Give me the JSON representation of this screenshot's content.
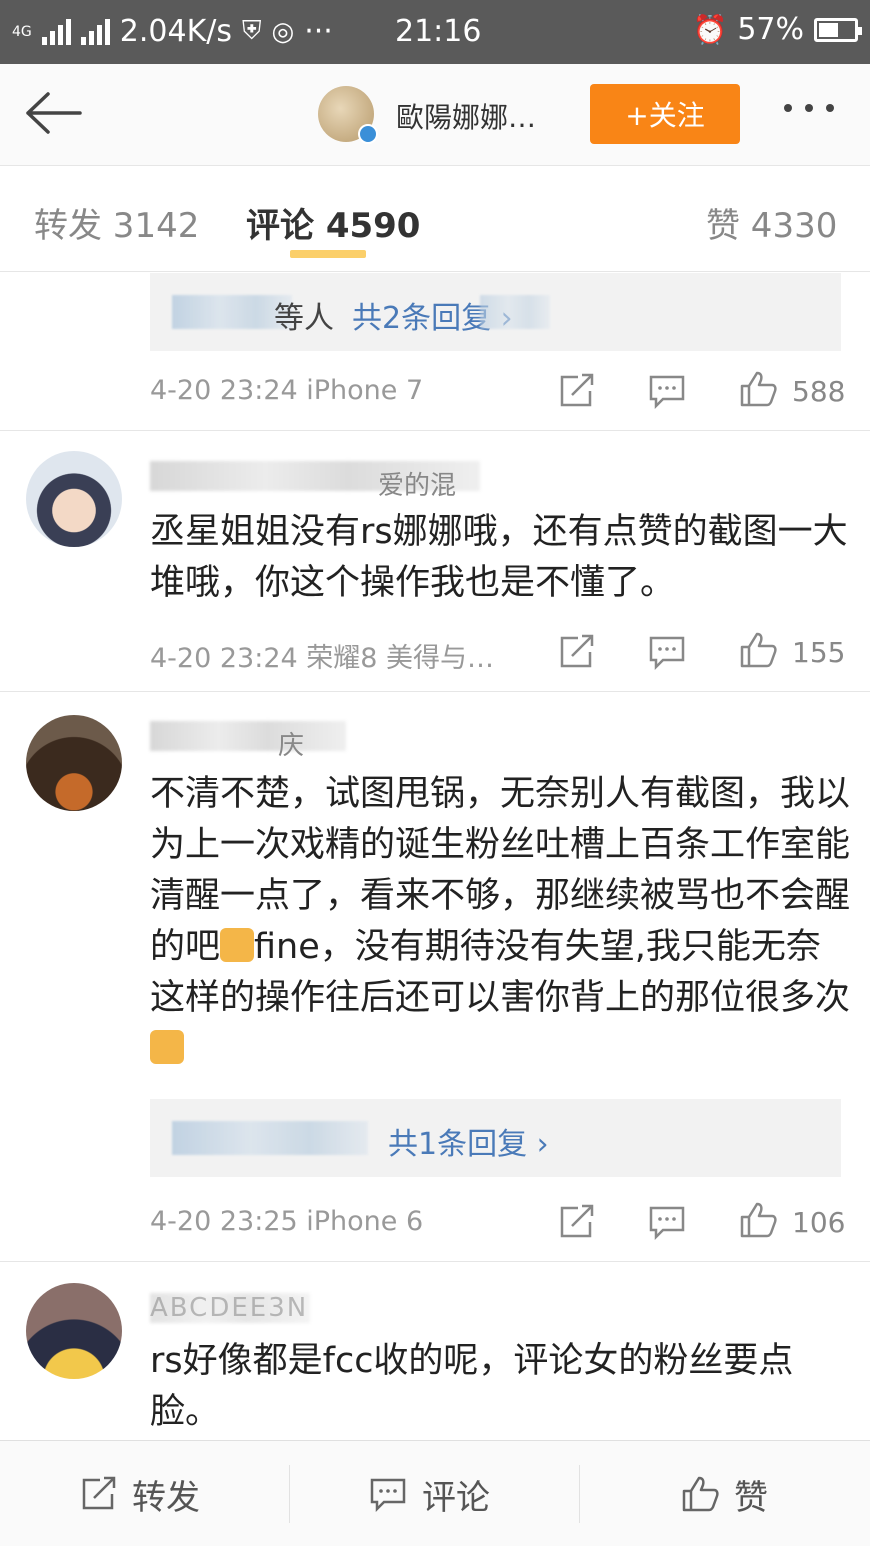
{
  "statusbar": {
    "network_1": "4G",
    "speed": "2.04K/s",
    "time": "21:16",
    "battery": "57%",
    "battery_level": 0.57
  },
  "header": {
    "username": "歐陽娜娜…",
    "follow_label": "+关注"
  },
  "tabs": {
    "repost": "转发 3142",
    "comment": "评论 4590",
    "like": "赞 4330"
  },
  "comments": [
    {
      "reply_box_name_visible": "等人",
      "reply_box_text": "共2条回复 ›",
      "meta": "4-20 23:24  iPhone 7",
      "likes": "588"
    },
    {
      "username_visible": "爱的混",
      "text": "丞星姐姐没有rs娜娜哦，还有点赞的截图一大堆哦，你这个操作我也是不懂了。",
      "meta": "4-20 23:24  荣耀8 美得与…",
      "likes": "155"
    },
    {
      "username_visible": "庆",
      "text": "不清不楚，试图甩锅，无奈别人有截图，我以为上一次戏精的诞生粉丝吐槽上百条工作室能清醒一点了，看来不够，那继续被骂也不会醒的吧",
      "text_mid": "fine，没有期待没有失望,我只能无奈这样的操作往后还可以害你背上的那位很多次",
      "reply_box_text": "共1条回复 ›",
      "meta": "4-20 23:25  iPhone 6",
      "likes": "106"
    },
    {
      "username_visible": "ABCDEE3N",
      "text": "rs好像都是fcc收的呢，评论女的粉丝要点脸。"
    }
  ],
  "bottombar": {
    "repost": "转发",
    "comment": "评论",
    "like": "赞"
  },
  "colors": {
    "follow": "#f98516",
    "link": "#4a7ab8",
    "tab_indicator": "#fbcf6a"
  }
}
